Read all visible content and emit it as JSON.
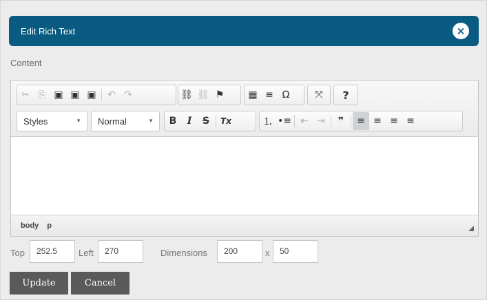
{
  "dialog": {
    "title": "Edit Rich Text",
    "close_icon_char": "×",
    "content_label": "Content"
  },
  "toolbar": {
    "styles_combo": "Styles",
    "format_combo": "Normal",
    "icons": {
      "cut": "✂",
      "copy": "⎘",
      "paste": "▣",
      "paste_text": "▣",
      "paste_word": "▣",
      "undo": "↶",
      "redo": "↷",
      "link": "⛓",
      "unlink": "⛓",
      "anchor": "⚑",
      "table": "▦",
      "hline": "≡",
      "special_char": "Ω",
      "maximize": "⤧",
      "help": "?",
      "bold": "B",
      "italic": "I",
      "strike": "S",
      "remove_format": "Tx",
      "numbered_list": "⒈",
      "bulleted_list": "•≡",
      "outdent": "⇤",
      "indent": "⇥",
      "blockquote": "❞",
      "align_left": "≡",
      "align_center": "≡",
      "align_right": "≡",
      "justify": "≡"
    }
  },
  "statusbar": {
    "path": [
      "body",
      "p"
    ]
  },
  "fields": {
    "top_label": "Top",
    "top_value": "252.5",
    "left_label": "Left",
    "left_value": "270",
    "dimensions_label": "Dimensions",
    "width_value": "200",
    "x_separator": "x",
    "height_value": "50"
  },
  "buttons": {
    "update": "Update",
    "cancel": "Cancel"
  }
}
